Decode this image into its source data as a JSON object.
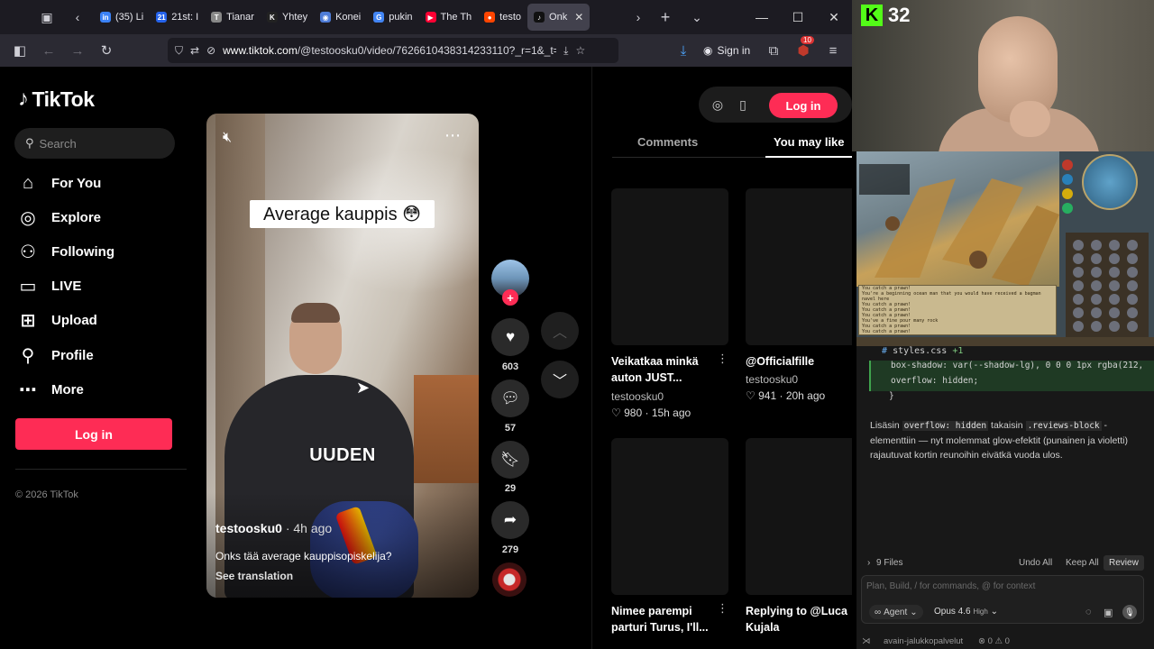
{
  "browser": {
    "tabs": [
      {
        "label": "(35) Li",
        "color": "#3b82f6",
        "glyph": "in"
      },
      {
        "label": "21st: I",
        "color": "#2563eb",
        "glyph": "21"
      },
      {
        "label": "Tianar",
        "color": "#888888",
        "glyph": "T"
      },
      {
        "label": "Yhtey",
        "color": "#222222",
        "glyph": "K"
      },
      {
        "label": "Konei",
        "color": "#4f7dd8",
        "glyph": "◉"
      },
      {
        "label": "pukin",
        "color": "#4285f4",
        "glyph": "G"
      },
      {
        "label": "The Th",
        "color": "#ff0033",
        "glyph": "▶"
      },
      {
        "label": "testo",
        "color": "#ff4500",
        "glyph": "●"
      },
      {
        "label": "Onk",
        "color": "#111111",
        "glyph": "♪",
        "active": true
      }
    ],
    "url_host": "www.tiktok.com",
    "url_path": "/@testoosku0/video/7626610438314233110?_r=1&_t=",
    "sign_in_label": "Sign in",
    "extension_badge": "10"
  },
  "tiktok": {
    "logo_text": "TikTok",
    "search_placeholder": "Search",
    "nav": [
      {
        "label": "For You",
        "icon": "home-icon"
      },
      {
        "label": "Explore",
        "icon": "compass-icon"
      },
      {
        "label": "Following",
        "icon": "following-icon"
      },
      {
        "label": "LIVE",
        "icon": "live-icon"
      },
      {
        "label": "Upload",
        "icon": "upload-icon"
      },
      {
        "label": "Profile",
        "icon": "profile-icon"
      },
      {
        "label": "More",
        "icon": "more-icon"
      }
    ],
    "login_label": "Log in",
    "copyright": "© 2026 TikTok",
    "video": {
      "caption_box": "Average kauppis 😳",
      "overlay_text": "UUDEN",
      "author": "testoosku0",
      "time": "4h ago",
      "description": "Onks tää average kauppisopiskelija?",
      "see_translation": "See translation"
    },
    "actions": {
      "likes": "603",
      "comments": "57",
      "saves": "29",
      "shares": "279"
    },
    "right_panel": {
      "login_label": "Log in",
      "tab_comments": "Comments",
      "tab_you_may_like": "You may like",
      "cards": [
        {
          "title": "Veikatkaa minkä auton JUST...",
          "user": "testoosku0",
          "likes": "980",
          "time": "15h ago"
        },
        {
          "title": "@Officialfille",
          "user": "testoosku0",
          "likes": "941",
          "time": "20h ago"
        },
        {
          "title": "Nimee parempi parturi Turus, I'll...",
          "user": "",
          "likes": "",
          "time": ""
        },
        {
          "title": "Replying to @Luca Kujala",
          "user": "",
          "likes": "",
          "time": ""
        }
      ]
    }
  },
  "overlay": {
    "viewer_count": "32",
    "game_chat": [
      "You catch a prawn!",
      "You're a beginning ocean man that you would have received a bagman navel here",
      "You catch a prawn!",
      "You catch a prawn!",
      "You catch a prawn!",
      "You've a fine pour many rock",
      "You catch a prawn!",
      "You catch a prawn!"
    ],
    "editor": {
      "filename": "styles.css",
      "filename_mod": "+1",
      "code_lines": [
        "box-shadow: var(--shadow-lg), 0 0 0 1px rgba(212,",
        "overflow: hidden;",
        "}"
      ],
      "message_pre": "Lisäsin ",
      "message_code1": "overflow: hidden",
      "message_mid": " takaisin ",
      "message_code2": ".reviews-block",
      "message_post": " -elementtiin — nyt molemmat glow-efektit (punainen ja violetti) rajautuvat kortin reunoihin eivätkä vuoda ulos.",
      "files_label": "9 Files",
      "undo_all": "Undo All",
      "keep_all": "Keep All",
      "review": "Review",
      "input_placeholder": "Plan, Build, / for commands, @ for context",
      "agent_label": "Agent",
      "model_label": "Opus 4.6",
      "model_level": "High",
      "status_branch": "avain-jalukkopalvelut",
      "status_errors": "⊗ 0 ⚠ 0"
    }
  }
}
